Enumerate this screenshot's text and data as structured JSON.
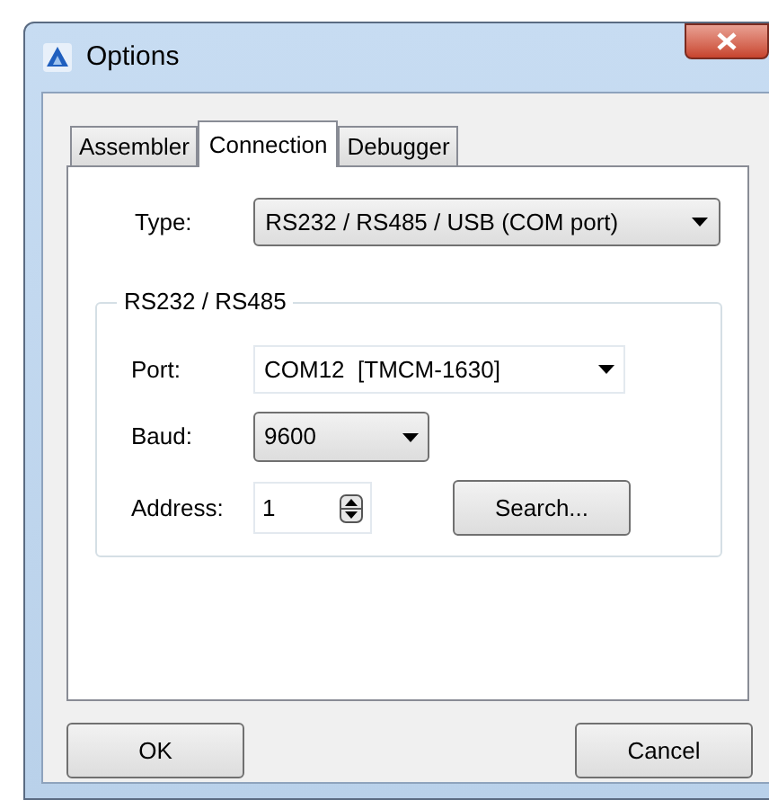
{
  "window": {
    "title": "Options"
  },
  "tabs": [
    {
      "label": "Assembler",
      "selected": false
    },
    {
      "label": "Connection",
      "selected": true
    },
    {
      "label": "Debugger",
      "selected": false
    }
  ],
  "type": {
    "label": "Type:",
    "value": "RS232 / RS485 / USB (COM port)"
  },
  "group": {
    "title": "RS232 / RS485",
    "port": {
      "label": "Port:",
      "value": "COM12  [TMCM-1630]"
    },
    "baud": {
      "label": "Baud:",
      "value": "9600"
    },
    "address": {
      "label": "Address:",
      "value": "1"
    },
    "search_button": "Search..."
  },
  "buttons": [
    "OK",
    "Cancel"
  ]
}
